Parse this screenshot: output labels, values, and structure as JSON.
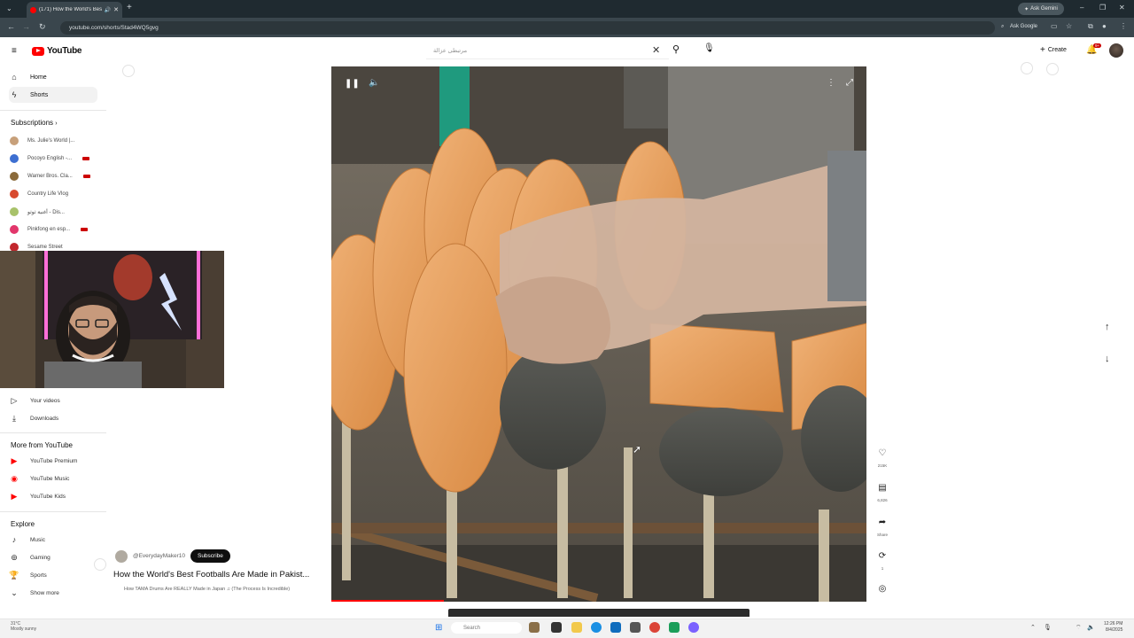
{
  "browser": {
    "tab_title": "(171) How the World's Bes",
    "tab_count_hint": "171",
    "url": "youtube.com/shorts/Stad4WQ5gvg",
    "ask_gemini": "Ask Gemini",
    "ask_google": "Ask Google"
  },
  "header": {
    "logo_text": "YouTube",
    "search_placeholder": "مرتبطی عزالة",
    "create_label": "Create",
    "notification_count": "9+"
  },
  "sidebar": {
    "nav": [
      {
        "label": "Home",
        "icon": "home-icon"
      },
      {
        "label": "Shorts",
        "icon": "shorts-icon"
      }
    ],
    "subscriptions_heading": "Subscriptions",
    "subscriptions": [
      {
        "label": "Ms. Julie's World |...",
        "color": "#c7a07a"
      },
      {
        "label": "Pocoyo English -...",
        "color": "#3d6fd1"
      },
      {
        "label": "Warner Bros. Cla...",
        "color": "#8a6a3a"
      },
      {
        "label": "Country Life Vlog",
        "color": "#d84a2e"
      },
      {
        "label": "أغنية ثوثو - Dis...",
        "color": "#a8c26a"
      },
      {
        "label": "Pinkfong en esp...",
        "color": "#e2366b"
      },
      {
        "label": "Sesame Street",
        "color": "#c2272d"
      }
    ],
    "you_items": [
      {
        "label": "Your videos",
        "icon": "video-icon"
      },
      {
        "label": "Downloads",
        "icon": "download-icon"
      }
    ],
    "more_heading": "More from YouTube",
    "more_items": [
      {
        "label": "YouTube Premium"
      },
      {
        "label": "YouTube Music"
      },
      {
        "label": "YouTube Kids"
      }
    ],
    "explore_heading": "Explore",
    "explore_items": [
      {
        "label": "Music",
        "icon": "music-icon"
      },
      {
        "label": "Gaming",
        "icon": "gaming-icon"
      },
      {
        "label": "Sports",
        "icon": "trophy-icon"
      }
    ],
    "show_more": "Show more"
  },
  "video": {
    "channel": "@EverydayMaker10",
    "subscribe_label": "Subscribe",
    "title": "How the World's Best Footballs Are Made in Pakist...",
    "subtitle": "How TAMA Drums Are REALLY Made in Japan ♫ (The Process Is Incredible)",
    "progress_fraction": 0.21
  },
  "actions": {
    "likes": "215K",
    "comments": "6,826",
    "share": "Share",
    "remix": "1"
  },
  "taskbar": {
    "search_placeholder": "Search",
    "weather_temp": "31°C",
    "weather_desc": "Mostly sunny",
    "time": "12:26 PM",
    "date": "8/4/2025"
  }
}
